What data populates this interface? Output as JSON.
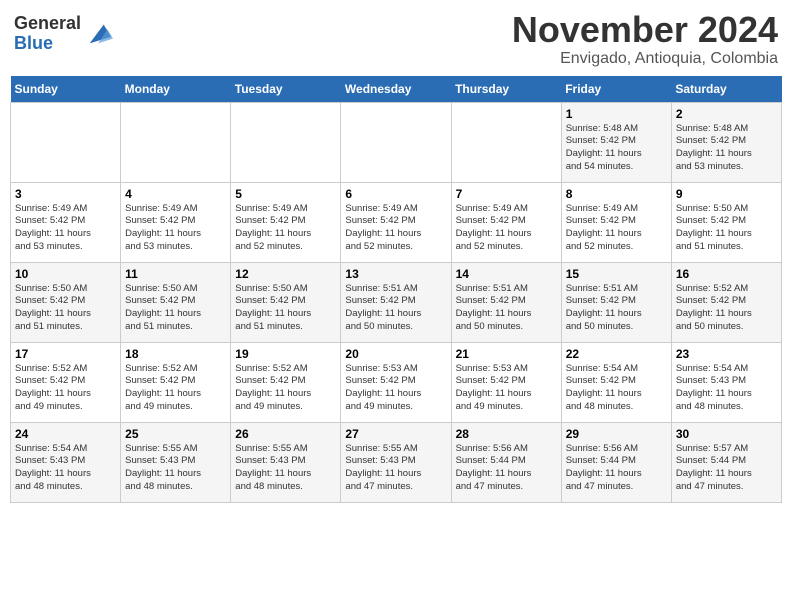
{
  "logo": {
    "general": "General",
    "blue": "Blue"
  },
  "title": "November 2024",
  "location": "Envigado, Antioquia, Colombia",
  "headers": [
    "Sunday",
    "Monday",
    "Tuesday",
    "Wednesday",
    "Thursday",
    "Friday",
    "Saturday"
  ],
  "weeks": [
    [
      {
        "day": "",
        "info": ""
      },
      {
        "day": "",
        "info": ""
      },
      {
        "day": "",
        "info": ""
      },
      {
        "day": "",
        "info": ""
      },
      {
        "day": "",
        "info": ""
      },
      {
        "day": "1",
        "info": "Sunrise: 5:48 AM\nSunset: 5:42 PM\nDaylight: 11 hours\nand 54 minutes."
      },
      {
        "day": "2",
        "info": "Sunrise: 5:48 AM\nSunset: 5:42 PM\nDaylight: 11 hours\nand 53 minutes."
      }
    ],
    [
      {
        "day": "3",
        "info": "Sunrise: 5:49 AM\nSunset: 5:42 PM\nDaylight: 11 hours\nand 53 minutes."
      },
      {
        "day": "4",
        "info": "Sunrise: 5:49 AM\nSunset: 5:42 PM\nDaylight: 11 hours\nand 53 minutes."
      },
      {
        "day": "5",
        "info": "Sunrise: 5:49 AM\nSunset: 5:42 PM\nDaylight: 11 hours\nand 52 minutes."
      },
      {
        "day": "6",
        "info": "Sunrise: 5:49 AM\nSunset: 5:42 PM\nDaylight: 11 hours\nand 52 minutes."
      },
      {
        "day": "7",
        "info": "Sunrise: 5:49 AM\nSunset: 5:42 PM\nDaylight: 11 hours\nand 52 minutes."
      },
      {
        "day": "8",
        "info": "Sunrise: 5:49 AM\nSunset: 5:42 PM\nDaylight: 11 hours\nand 52 minutes."
      },
      {
        "day": "9",
        "info": "Sunrise: 5:50 AM\nSunset: 5:42 PM\nDaylight: 11 hours\nand 51 minutes."
      }
    ],
    [
      {
        "day": "10",
        "info": "Sunrise: 5:50 AM\nSunset: 5:42 PM\nDaylight: 11 hours\nand 51 minutes."
      },
      {
        "day": "11",
        "info": "Sunrise: 5:50 AM\nSunset: 5:42 PM\nDaylight: 11 hours\nand 51 minutes."
      },
      {
        "day": "12",
        "info": "Sunrise: 5:50 AM\nSunset: 5:42 PM\nDaylight: 11 hours\nand 51 minutes."
      },
      {
        "day": "13",
        "info": "Sunrise: 5:51 AM\nSunset: 5:42 PM\nDaylight: 11 hours\nand 50 minutes."
      },
      {
        "day": "14",
        "info": "Sunrise: 5:51 AM\nSunset: 5:42 PM\nDaylight: 11 hours\nand 50 minutes."
      },
      {
        "day": "15",
        "info": "Sunrise: 5:51 AM\nSunset: 5:42 PM\nDaylight: 11 hours\nand 50 minutes."
      },
      {
        "day": "16",
        "info": "Sunrise: 5:52 AM\nSunset: 5:42 PM\nDaylight: 11 hours\nand 50 minutes."
      }
    ],
    [
      {
        "day": "17",
        "info": "Sunrise: 5:52 AM\nSunset: 5:42 PM\nDaylight: 11 hours\nand 49 minutes."
      },
      {
        "day": "18",
        "info": "Sunrise: 5:52 AM\nSunset: 5:42 PM\nDaylight: 11 hours\nand 49 minutes."
      },
      {
        "day": "19",
        "info": "Sunrise: 5:52 AM\nSunset: 5:42 PM\nDaylight: 11 hours\nand 49 minutes."
      },
      {
        "day": "20",
        "info": "Sunrise: 5:53 AM\nSunset: 5:42 PM\nDaylight: 11 hours\nand 49 minutes."
      },
      {
        "day": "21",
        "info": "Sunrise: 5:53 AM\nSunset: 5:42 PM\nDaylight: 11 hours\nand 49 minutes."
      },
      {
        "day": "22",
        "info": "Sunrise: 5:54 AM\nSunset: 5:42 PM\nDaylight: 11 hours\nand 48 minutes."
      },
      {
        "day": "23",
        "info": "Sunrise: 5:54 AM\nSunset: 5:43 PM\nDaylight: 11 hours\nand 48 minutes."
      }
    ],
    [
      {
        "day": "24",
        "info": "Sunrise: 5:54 AM\nSunset: 5:43 PM\nDaylight: 11 hours\nand 48 minutes."
      },
      {
        "day": "25",
        "info": "Sunrise: 5:55 AM\nSunset: 5:43 PM\nDaylight: 11 hours\nand 48 minutes."
      },
      {
        "day": "26",
        "info": "Sunrise: 5:55 AM\nSunset: 5:43 PM\nDaylight: 11 hours\nand 48 minutes."
      },
      {
        "day": "27",
        "info": "Sunrise: 5:55 AM\nSunset: 5:43 PM\nDaylight: 11 hours\nand 47 minutes."
      },
      {
        "day": "28",
        "info": "Sunrise: 5:56 AM\nSunset: 5:44 PM\nDaylight: 11 hours\nand 47 minutes."
      },
      {
        "day": "29",
        "info": "Sunrise: 5:56 AM\nSunset: 5:44 PM\nDaylight: 11 hours\nand 47 minutes."
      },
      {
        "day": "30",
        "info": "Sunrise: 5:57 AM\nSunset: 5:44 PM\nDaylight: 11 hours\nand 47 minutes."
      }
    ]
  ]
}
